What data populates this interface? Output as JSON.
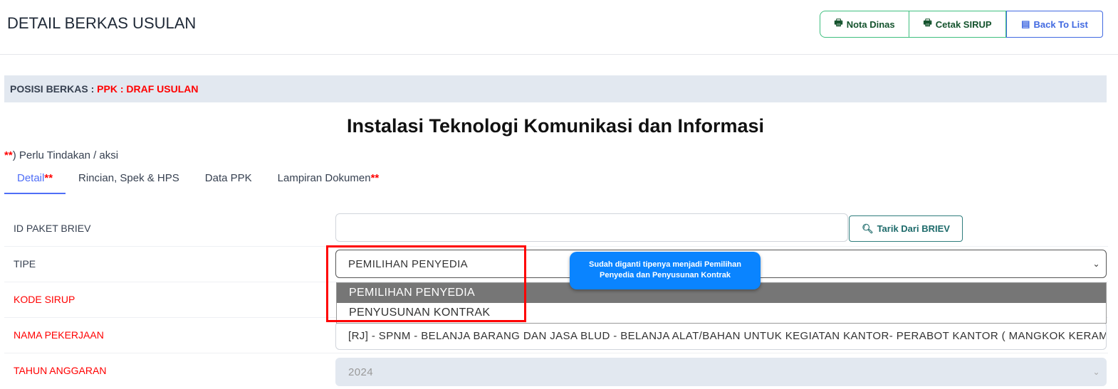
{
  "header": {
    "title": "DETAIL BERKAS USULAN",
    "buttons": {
      "nota": "Nota Dinas",
      "cetak": "Cetak SIRUP",
      "back": "Back To List"
    }
  },
  "posisi": {
    "label": "POSISI BERKAS : ",
    "value": "PPK : DRAF USULAN"
  },
  "heading": "Instalasi Teknologi Komunikasi dan Informasi",
  "note": {
    "stars": "**",
    "text": ") Perlu Tindakan / aksi"
  },
  "tabs": [
    {
      "label": "Detail",
      "star": "**"
    },
    {
      "label": "Rincian, Spek & HPS"
    },
    {
      "label": "Data PPK"
    },
    {
      "label": "Lampiran Dokumen",
      "star": "**"
    }
  ],
  "form": {
    "id_paket": {
      "label": "ID PAKET BRIEV",
      "value": "",
      "button": "Tarik Dari BRIEV"
    },
    "tipe": {
      "label": "TIPE",
      "value": "PEMILIHAN PENYEDIA",
      "options": [
        "PEMILIHAN PENYEDIA",
        "PENYUSUNAN KONTRAK"
      ]
    },
    "kode_sirup": {
      "label": "KODE SIRUP"
    },
    "nama_pekerjaan": {
      "label": "NAMA PEKERJAAN",
      "value": "[RJ] - SPNM - BELANJA BARANG DAN JASA BLUD - BELANJA ALAT/BAHAN UNTUK KEGIATAN KANTOR- PERABOT KANTOR ( MANGKOK KERAMIK )"
    },
    "tahun": {
      "label": "TAHUN ANGGARAN",
      "value": "2024"
    }
  },
  "annotation": "Sudah diganti tipenya menjadi Pemilihan Penyedia dan Penyusunan Kontrak"
}
